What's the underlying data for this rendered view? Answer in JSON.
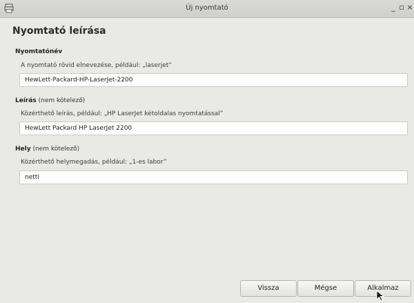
{
  "window": {
    "title": "Új nyomtató",
    "controls": {
      "minimize": "_",
      "maximize": "▫",
      "close": "×"
    }
  },
  "page": {
    "heading": "Nyomtató leírása"
  },
  "printer_name": {
    "label": "Nyomtatónév",
    "hint": "A nyomtató rövid elnevezése, például: „laserjet”",
    "value": "HewLett-Packard-HP-LaserJet-2200"
  },
  "description": {
    "label": "Leírás",
    "optional": " (nem kötelező)",
    "hint": "Közérthető leírás, például: „HP LaserJet kétoldalas nyomtatással”",
    "value": "HewLett Packard HP LaserJet 2200"
  },
  "location": {
    "label": "Hely",
    "optional": " (nem kötelező)",
    "hint": "Közérthető helymegadás, például: „1-es labor”",
    "value": "netti"
  },
  "buttons": {
    "back": "Vissza",
    "cancel": "Mégse",
    "apply": "Alkalmaz"
  },
  "icons": {
    "app": "printer-icon",
    "cursor": "mouse-pointer-icon"
  }
}
